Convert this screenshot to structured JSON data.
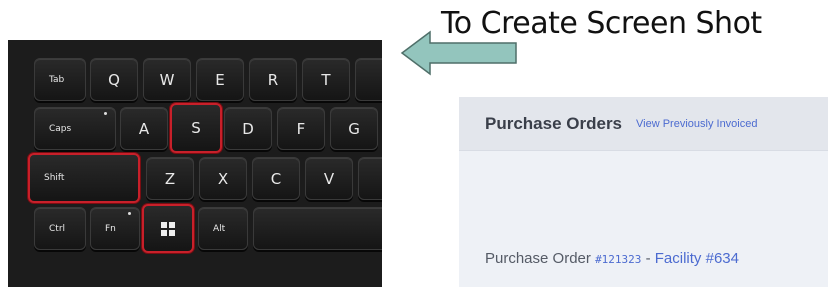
{
  "heading": "To Create Screen Shot",
  "keyboard": {
    "row1": [
      "Tab",
      "Q",
      "W",
      "E",
      "R",
      "T"
    ],
    "row2": [
      "Caps",
      "A",
      "S",
      "D",
      "F",
      "G"
    ],
    "row3": [
      "Shift",
      "Z",
      "X",
      "C",
      "V"
    ],
    "row4": [
      "Ctrl",
      "Fn",
      "Alt"
    ],
    "highlighted_keys": [
      "S",
      "Shift",
      "Windows"
    ]
  },
  "purchase_orders": {
    "title": "Purchase Orders",
    "link": "View Previously Invoiced",
    "order_label": "Purchase Order",
    "order_number": "#121323",
    "separator": "-",
    "facility": "Facility #634"
  },
  "colors": {
    "highlight": "#c8202a",
    "arrow_fill": "#93c5bd",
    "link": "#4c6bd0"
  },
  "icons": [
    "left-arrow-icon",
    "windows-icon"
  ]
}
